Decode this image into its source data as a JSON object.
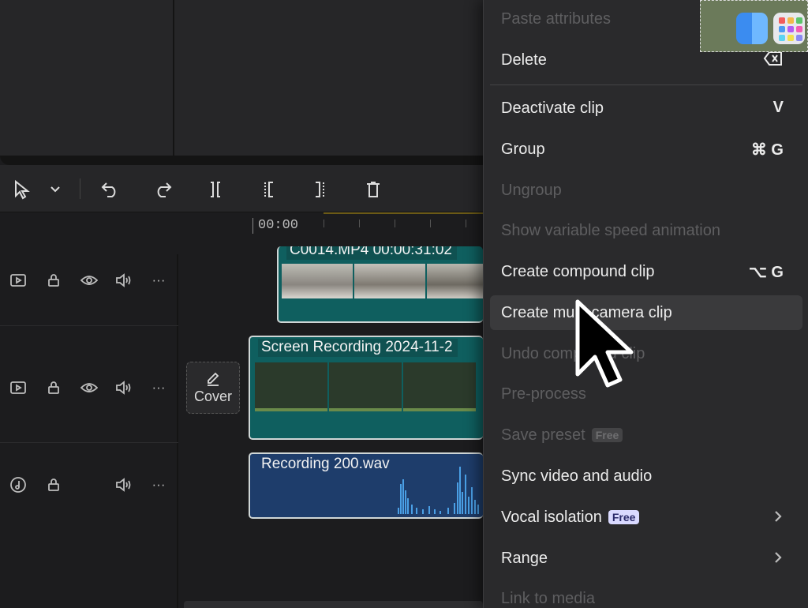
{
  "toolbar": {
    "tools": [
      "select-tool",
      "select-dropdown",
      "undo",
      "redo",
      "split",
      "trim-left",
      "trim-right",
      "delete"
    ]
  },
  "ruler": {
    "timecode": "00:00"
  },
  "tracks": [
    {
      "kind": "video",
      "clip_title": "C0014.MP4   00:00:31:02"
    },
    {
      "kind": "video",
      "clip_title": "Screen Recording 2024-11-2",
      "cover_label": "Cover"
    },
    {
      "kind": "audio",
      "clip_title": "Recording 200.wav"
    }
  ],
  "menu": {
    "items": [
      {
        "label": "Paste attributes",
        "disabled": true
      },
      {
        "label": "Delete",
        "shortcut_icon": "delete-key-icon"
      },
      {
        "label": "Deactivate clip",
        "shortcut": "V"
      },
      {
        "label": "Group",
        "shortcut": "⌘  G"
      },
      {
        "label": "Ungroup",
        "disabled": true
      },
      {
        "label": "Show variable speed animation",
        "disabled": true
      },
      {
        "label": "Create compound clip",
        "shortcut": "⌥  G"
      },
      {
        "label": "Create multi-camera clip",
        "hover": true
      },
      {
        "label": "Undo compound clip",
        "disabled": true
      },
      {
        "label": "Pre-process",
        "disabled": true
      },
      {
        "label": "Save preset",
        "disabled": true,
        "badge": "Free"
      },
      {
        "label": "Sync video and audio"
      },
      {
        "label": "Vocal isolation",
        "badge": "Free",
        "submenu": true
      },
      {
        "label": "Range",
        "submenu": true
      },
      {
        "label": "Link to media",
        "disabled": true
      }
    ]
  },
  "colors": {
    "menu_bg": "#2a2a2c",
    "video_clip": "#0f5f5f",
    "audio_clip": "#1e3d6b",
    "badge_active": "#d9d9ff"
  }
}
